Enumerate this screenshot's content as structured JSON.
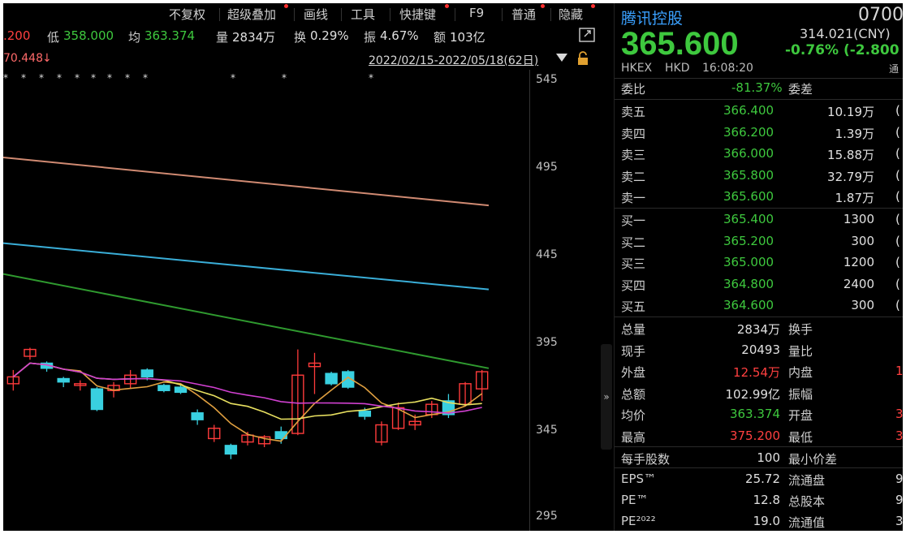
{
  "toolbar": {
    "items": [
      "不复权",
      "超级叠加",
      "画线",
      "工具",
      "快捷键",
      "F9",
      "普通",
      "隐藏"
    ]
  },
  "quote_strip": {
    "prev_tail": ".200",
    "low_label": "低",
    "low_value": "358.000",
    "avg_label": "均",
    "avg_value": "363.374",
    "vol_label": "量",
    "vol_value": "2834万",
    "turnover_label": "换",
    "turnover_value": "0.29%",
    "amplitude_label": "振",
    "amplitude_value": "4.67%",
    "amount_label": "额",
    "amount_value": "103亿"
  },
  "range_bar": {
    "left_value": "70.448",
    "arrow": "↓",
    "date_range": "2022/02/15-2022/05/18(62日)"
  },
  "chart_data": {
    "type": "candlestick",
    "y_ticks": [
      "545",
      "495",
      "445",
      "395",
      "345",
      "295"
    ],
    "ylim": [
      295,
      545
    ],
    "star_marker": "*",
    "ma_lines": [
      {
        "color": "#d08a72",
        "start": 500,
        "end": 472
      },
      {
        "color": "#3aaed8",
        "start": 450,
        "end": 423
      },
      {
        "color": "#2f9a2f",
        "start": 432,
        "end": 377
      }
    ],
    "candles": [
      {
        "o": 368,
        "c": 372,
        "h": 376,
        "l": 364
      },
      {
        "o": 384,
        "c": 388,
        "h": 389,
        "l": 382
      },
      {
        "o": 380,
        "c": 377,
        "h": 381,
        "l": 375
      },
      {
        "o": 371,
        "c": 369,
        "h": 372,
        "l": 366
      },
      {
        "o": 367,
        "c": 368,
        "h": 370,
        "l": 364
      },
      {
        "o": 365,
        "c": 353,
        "h": 366,
        "l": 352
      },
      {
        "o": 364,
        "c": 367,
        "h": 369,
        "l": 360
      },
      {
        "o": 368,
        "c": 373,
        "h": 376,
        "l": 365
      },
      {
        "o": 376,
        "c": 372,
        "h": 377,
        "l": 370
      },
      {
        "o": 367,
        "c": 364,
        "h": 368,
        "l": 363
      },
      {
        "o": 366,
        "c": 363,
        "h": 367,
        "l": 362
      },
      {
        "o": 351,
        "c": 347,
        "h": 353,
        "l": 344
      },
      {
        "o": 336,
        "c": 342,
        "h": 344,
        "l": 334
      },
      {
        "o": 332,
        "c": 327,
        "h": 333,
        "l": 324
      },
      {
        "o": 334,
        "c": 338,
        "h": 340,
        "l": 332
      },
      {
        "o": 333,
        "c": 337,
        "h": 338,
        "l": 331
      },
      {
        "o": 340,
        "c": 336,
        "h": 343,
        "l": 333
      },
      {
        "o": 339,
        "c": 373,
        "h": 388,
        "l": 338
      },
      {
        "o": 378,
        "c": 380,
        "h": 386,
        "l": 362
      },
      {
        "o": 374,
        "c": 368,
        "h": 375,
        "l": 367
      },
      {
        "o": 375,
        "c": 366,
        "h": 376,
        "l": 365
      },
      {
        "o": 352,
        "c": 349,
        "h": 354,
        "l": 347
      },
      {
        "o": 334,
        "c": 344,
        "h": 346,
        "l": 332
      },
      {
        "o": 342,
        "c": 354,
        "h": 357,
        "l": 341
      },
      {
        "o": 344,
        "c": 346,
        "h": 350,
        "l": 341
      },
      {
        "o": 350,
        "c": 356,
        "h": 358,
        "l": 348
      },
      {
        "o": 358,
        "c": 350,
        "h": 362,
        "l": 348
      },
      {
        "o": 356,
        "c": 368,
        "h": 369,
        "l": 355
      },
      {
        "o": 365,
        "c": 375,
        "h": 376,
        "l": 358
      }
    ]
  },
  "panel": {
    "name": "腾讯控股",
    "code": "0700",
    "price": "365.600",
    "cny_value": "314.021(CNY)",
    "change": "-0.76% (-2.800",
    "exchange": "HKEX",
    "currency": "HKD",
    "time": "16:08:20",
    "tong": "通",
    "weibi_label": "委比",
    "weibi_value": "-81.37%",
    "weicha_label": "委差",
    "asks": [
      {
        "label": "卖五",
        "price": "366.400",
        "vol": "10.19万",
        "tail": "("
      },
      {
        "label": "卖四",
        "price": "366.200",
        "vol": "1.39万",
        "tail": "("
      },
      {
        "label": "卖三",
        "price": "366.000",
        "vol": "15.88万",
        "tail": "("
      },
      {
        "label": "卖二",
        "price": "365.800",
        "vol": "32.79万",
        "tail": "("
      },
      {
        "label": "卖一",
        "price": "365.600",
        "vol": "1.87万",
        "tail": "("
      }
    ],
    "bids": [
      {
        "label": "买一",
        "price": "365.400",
        "vol": "1300",
        "tail": "("
      },
      {
        "label": "买二",
        "price": "365.200",
        "vol": "300",
        "tail": "("
      },
      {
        "label": "买三",
        "price": "365.000",
        "vol": "1200",
        "tail": "("
      },
      {
        "label": "买四",
        "price": "364.800",
        "vol": "2400",
        "tail": "("
      },
      {
        "label": "买五",
        "price": "364.600",
        "vol": "300",
        "tail": "("
      }
    ],
    "stats": [
      {
        "l1": "总量",
        "v1": "2834万",
        "l2": "换手",
        "v2": ""
      },
      {
        "l1": "现手",
        "v1": "20493",
        "l2": "量比",
        "v2": ""
      },
      {
        "l1": "外盘",
        "v1": "12.54万",
        "l2": "内盘",
        "v2": "1"
      },
      {
        "l1": "总额",
        "v1": "102.99亿",
        "l2": "振幅",
        "v2": ""
      },
      {
        "l1": "均价",
        "v1": "363.374",
        "l2": "开盘",
        "v2": "3"
      },
      {
        "l1": "最高",
        "v1": "375.200",
        "l2": "最低",
        "v2": "3"
      }
    ],
    "lot": {
      "l1": "每手股数",
      "v1": "100",
      "l2": "最小价差",
      "v2": ""
    },
    "fin": [
      {
        "l1": "EPS™",
        "v1": "25.72",
        "l2": "流通盘",
        "v2": "9"
      },
      {
        "l1": "PE™",
        "v1": "12.8",
        "l2": "总股本",
        "v2": "9"
      },
      {
        "l1": "PE²⁰²²",
        "v1": "19.0",
        "l2": "流通值",
        "v2": "3!"
      }
    ]
  },
  "colors": {
    "up": "#ff3b3b",
    "down": "#39d0e0",
    "green": "#3ec83e",
    "red": "#ff4040",
    "header_blue": "#3aa0ff"
  }
}
